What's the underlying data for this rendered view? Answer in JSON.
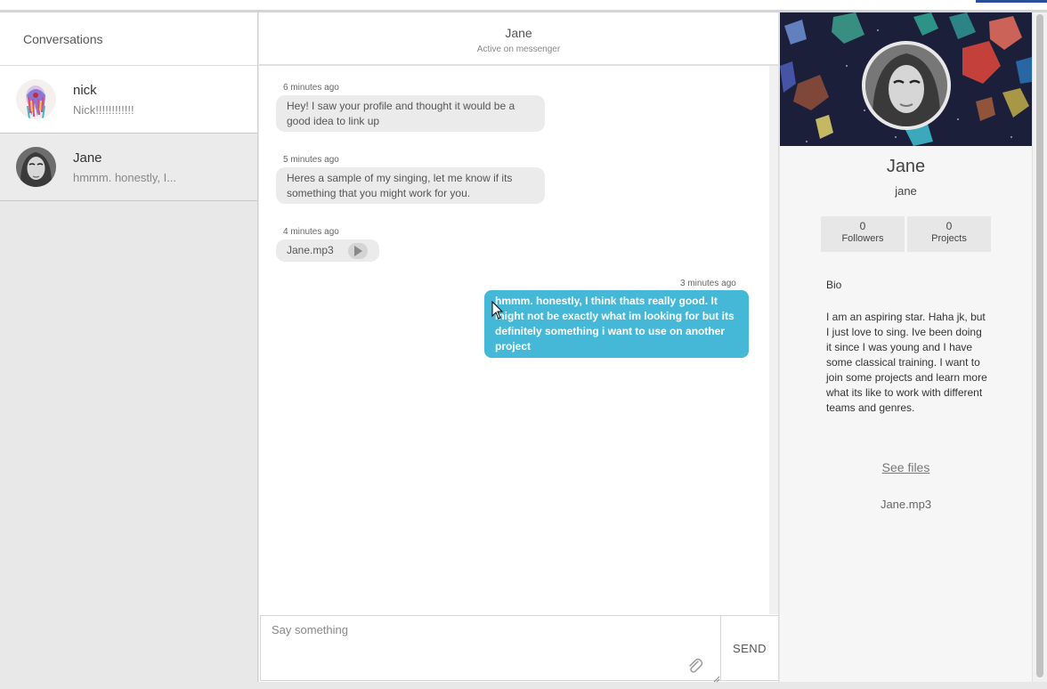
{
  "sidebar": {
    "header": "Conversations",
    "conversations": [
      {
        "name": "nick",
        "preview": "Nick!!!!!!!!!!!!"
      },
      {
        "name": "Jane",
        "preview": "hmmm. honestly, I..."
      }
    ]
  },
  "chat": {
    "title": "Jane",
    "subtitle": "Active on messenger",
    "messages": [
      {
        "time": "6 minutes ago",
        "text": "Hey! I saw your profile and thought it would be a good idea to link up"
      },
      {
        "time": "5 minutes ago",
        "text": "Heres a sample of my singing, let me know if its something that you might work for you."
      },
      {
        "time": "4 minutes ago",
        "file": "Jane.mp3"
      },
      {
        "time": "3 minutes ago",
        "text": "hmmm. honestly, I think thats really good. It might not be exactly what im looking for but its definitely something i want to use on another project"
      }
    ],
    "composer": {
      "placeholder": "Say something",
      "send_label": "SEND"
    }
  },
  "profile": {
    "name": "Jane",
    "username": "jane",
    "followers_count": "0",
    "followers_label": "Followers",
    "projects_count": "0",
    "projects_label": "Projects",
    "bio_title": "Bio",
    "bio": "I am an aspiring star. Haha jk, but I just love to sing. Ive been doing it since I was young and I have some classical training. I want to join some projects and learn more what its like to work with different teams and genres.",
    "see_files": "See files",
    "file": "Jane.mp3"
  },
  "colors": {
    "accent": "#45b8d8",
    "sidebar_bg": "#e8e8e8",
    "bubble_bg": "#ebebeb"
  }
}
